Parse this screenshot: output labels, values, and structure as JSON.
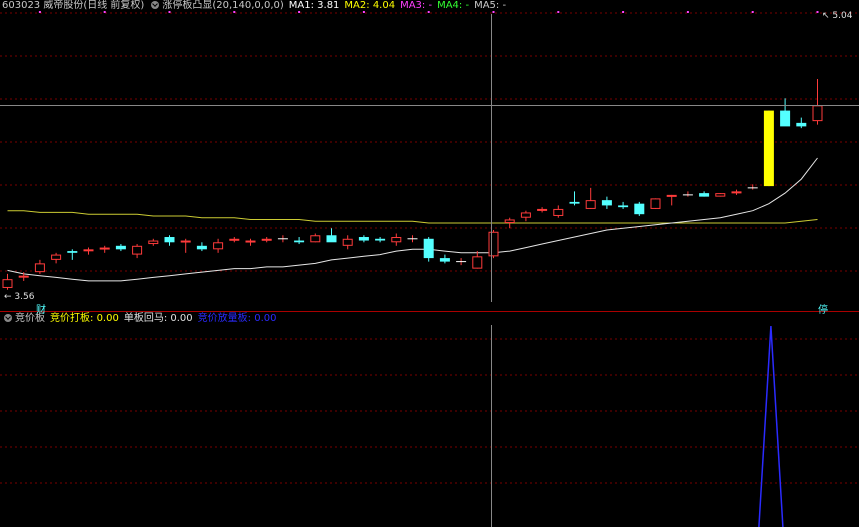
{
  "header": {
    "stock": "603023 威帝股份(日线 前复权)",
    "indicator": "涨停板凸显(20,140,0,0,0)",
    "ma1_label": "MA1:",
    "ma1_value": "3.81",
    "ma2_label": "MA2:",
    "ma2_value": "4.04",
    "ma3": "MA3: -",
    "ma4": "MA4: -",
    "ma5": "MA5: -"
  },
  "lower_header": {
    "name": "竞价板",
    "f1_label": "竞价打板:",
    "f1_value": "0.00",
    "f2_label": "单板回马:",
    "f2_value": "0.00",
    "f3_label": "竞价放量板:",
    "f3_value": "0.00"
  },
  "labels": {
    "high": "5.04",
    "low": "3.56",
    "mark_cai": "财",
    "mark_ting": "停"
  },
  "colors": {
    "up": "#ff3b3b",
    "down": "#54ffff",
    "limit_up": "#ffff00",
    "ma1": "#e6e6e6",
    "ma2": "#cccc33",
    "ma3": "#ff40ff",
    "ma4": "#33ff33",
    "crosshair": "#888888",
    "grid": "#7a0000",
    "divider": "#aa0000",
    "spike": "#2b2bff"
  },
  "chart_data": [
    {
      "type": "candlestick",
      "price_range": [
        3.48,
        5.12
      ],
      "limit_up_day": 47,
      "ohlc": [
        [
          3.56,
          3.64,
          3.55,
          3.61
        ],
        [
          3.62,
          3.65,
          3.6,
          3.63
        ],
        [
          3.65,
          3.72,
          3.64,
          3.7
        ],
        [
          3.72,
          3.76,
          3.7,
          3.75
        ],
        [
          3.77,
          3.78,
          3.72,
          3.76
        ],
        [
          3.77,
          3.79,
          3.75,
          3.78
        ],
        [
          3.78,
          3.8,
          3.76,
          3.79
        ],
        [
          3.8,
          3.81,
          3.77,
          3.78
        ],
        [
          3.75,
          3.81,
          3.73,
          3.8
        ],
        [
          3.81,
          3.84,
          3.8,
          3.83
        ],
        [
          3.85,
          3.86,
          3.8,
          3.82
        ],
        [
          3.82,
          3.84,
          3.76,
          3.83
        ],
        [
          3.8,
          3.82,
          3.77,
          3.78
        ],
        [
          3.78,
          3.84,
          3.76,
          3.82
        ],
        [
          3.83,
          3.85,
          3.82,
          3.84
        ],
        [
          3.82,
          3.84,
          3.8,
          3.83
        ],
        [
          3.83,
          3.85,
          3.82,
          3.84
        ],
        [
          3.84,
          3.86,
          3.82,
          3.84
        ],
        [
          3.83,
          3.85,
          3.81,
          3.82
        ],
        [
          3.82,
          3.87,
          3.82,
          3.86
        ],
        [
          3.86,
          3.9,
          3.84,
          3.82
        ],
        [
          3.8,
          3.86,
          3.78,
          3.84
        ],
        [
          3.85,
          3.86,
          3.82,
          3.83
        ],
        [
          3.84,
          3.85,
          3.82,
          3.83
        ],
        [
          3.82,
          3.87,
          3.8,
          3.85
        ],
        [
          3.84,
          3.86,
          3.82,
          3.84
        ],
        [
          3.84,
          3.85,
          3.71,
          3.73
        ],
        [
          3.73,
          3.75,
          3.7,
          3.71
        ],
        [
          3.71,
          3.73,
          3.69,
          3.71
        ],
        [
          3.67,
          3.77,
          3.67,
          3.74
        ],
        [
          3.74,
          3.89,
          3.73,
          3.88
        ],
        [
          3.93,
          3.96,
          3.9,
          3.95
        ],
        [
          3.96,
          4.0,
          3.94,
          3.99
        ],
        [
          4.0,
          4.02,
          3.99,
          4.01
        ],
        [
          3.97,
          4.03,
          3.96,
          4.01
        ],
        [
          4.05,
          4.11,
          4.03,
          4.04
        ],
        [
          4.01,
          4.13,
          4.01,
          4.06
        ],
        [
          4.06,
          4.08,
          4.01,
          4.03
        ],
        [
          4.03,
          4.05,
          4.01,
          4.02
        ],
        [
          4.04,
          4.05,
          3.97,
          3.98
        ],
        [
          4.01,
          4.07,
          4.01,
          4.07
        ],
        [
          4.08,
          4.09,
          4.03,
          4.09
        ],
        [
          4.09,
          4.11,
          4.08,
          4.09
        ],
        [
          4.1,
          4.11,
          4.08,
          4.08
        ],
        [
          4.08,
          4.1,
          4.08,
          4.1
        ],
        [
          4.1,
          4.12,
          4.09,
          4.11
        ],
        [
          4.13,
          4.15,
          4.12,
          4.13
        ],
        [
          4.14,
          4.57,
          4.14,
          4.57
        ],
        [
          4.57,
          4.64,
          4.49,
          4.48
        ],
        [
          4.5,
          4.53,
          4.47,
          4.48
        ],
        [
          4.51,
          4.75,
          4.49,
          4.6
        ]
      ],
      "ma1": [
        3.66,
        3.64,
        3.63,
        3.62,
        3.61,
        3.6,
        3.6,
        3.6,
        3.61,
        3.62,
        3.63,
        3.64,
        3.65,
        3.66,
        3.67,
        3.67,
        3.68,
        3.68,
        3.69,
        3.7,
        3.72,
        3.73,
        3.74,
        3.75,
        3.77,
        3.78,
        3.78,
        3.77,
        3.76,
        3.76,
        3.76,
        3.77,
        3.79,
        3.81,
        3.83,
        3.85,
        3.87,
        3.89,
        3.9,
        3.91,
        3.92,
        3.93,
        3.94,
        3.95,
        3.96,
        3.98,
        4.0,
        4.04,
        4.1,
        4.18,
        4.3
      ],
      "ma2": [
        4.0,
        4.0,
        3.99,
        3.99,
        3.99,
        3.98,
        3.98,
        3.98,
        3.98,
        3.97,
        3.97,
        3.97,
        3.96,
        3.96,
        3.96,
        3.95,
        3.95,
        3.95,
        3.95,
        3.94,
        3.94,
        3.94,
        3.94,
        3.94,
        3.94,
        3.94,
        3.93,
        3.93,
        3.93,
        3.93,
        3.93,
        3.93,
        3.93,
        3.93,
        3.93,
        3.93,
        3.93,
        3.93,
        3.93,
        3.93,
        3.93,
        3.93,
        3.93,
        3.93,
        3.93,
        3.93,
        3.93,
        3.93,
        3.93,
        3.94,
        3.95
      ]
    },
    {
      "type": "line",
      "series_values": [
        0,
        0,
        0,
        0,
        0,
        0,
        0,
        0,
        0,
        0,
        0,
        0,
        0,
        0,
        0,
        0,
        0,
        0,
        0,
        0,
        0,
        0,
        0,
        0,
        0,
        0,
        0,
        0,
        0,
        0,
        0,
        0,
        0,
        0,
        0,
        0,
        0,
        0,
        0,
        0,
        0,
        0,
        0,
        0,
        0,
        0,
        0,
        0,
        0,
        0,
        0
      ],
      "spike_index": 47
    }
  ]
}
